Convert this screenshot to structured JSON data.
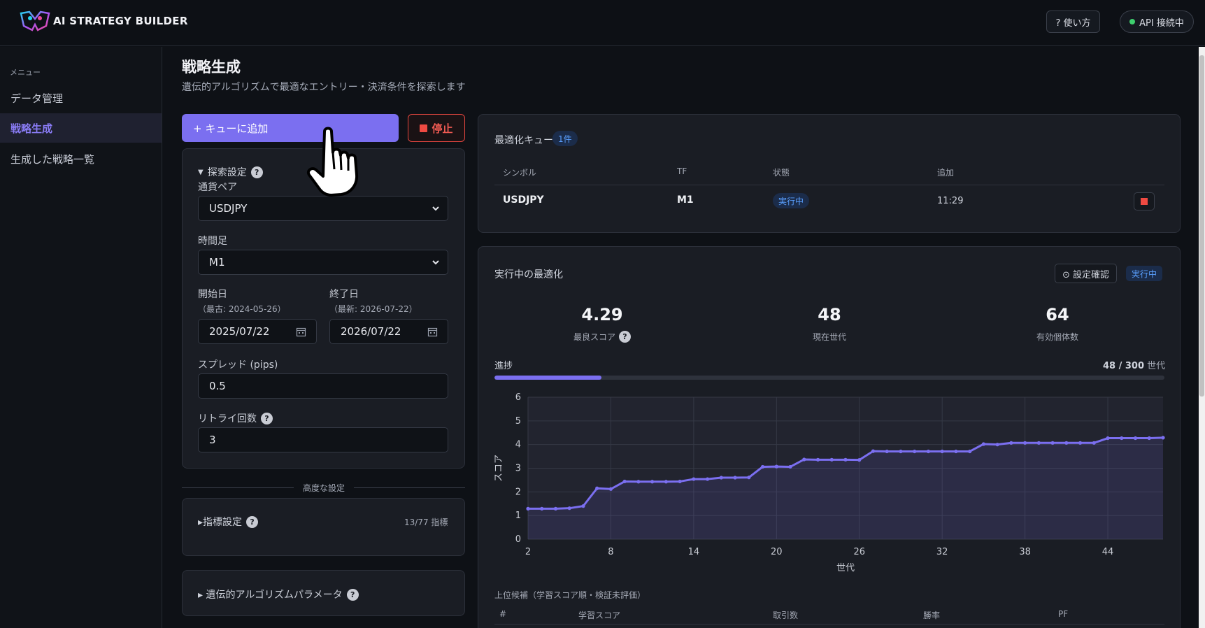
{
  "header": {
    "brand": "AI STRATEGY BUILDER",
    "help_label": "? 使い方",
    "api_status": "API 接続中",
    "api_color": "#3ecf6e"
  },
  "sidebar": {
    "caption": "メニュー",
    "items": [
      {
        "label": "データ管理",
        "active": false
      },
      {
        "label": "戦略生成",
        "active": true
      },
      {
        "label": "生成した戦略一覧",
        "active": false
      }
    ]
  },
  "page": {
    "title": "戦略生成",
    "subtitle": "遺伝的アルゴリズムで最適なエントリー・決済条件を探索します"
  },
  "actions": {
    "add_queue": "+ キューに追加",
    "stop": "停止"
  },
  "search": {
    "heading": "探索設定",
    "pair_label": "通貨ペア",
    "pair_value": "USDJPY",
    "tf_label": "時間足",
    "tf_value": "M1",
    "start_label": "開始日",
    "start_hint": "（最古: 2024-05-26）",
    "start_value": "2025/07/22",
    "end_label": "終了日",
    "end_hint": "（最新: 2026-07-22）",
    "end_value": "2026/07/22",
    "spread_label": "スプレッド (pips)",
    "spread_value": "0.5",
    "retry_label": "リトライ回数",
    "retry_value": "3"
  },
  "advanced": {
    "divider": "高度な設定",
    "indicators_label": "▸指標設定",
    "indicators_count": "13/77 指標",
    "ga_label": "▸ 遺伝的アルゴリズムパラメータ"
  },
  "queue": {
    "title": "最適化キュー",
    "count_badge": "1件",
    "columns": [
      "シンボル",
      "TF",
      "状態",
      "追加"
    ],
    "rows": [
      {
        "symbol": "USDJPY",
        "tf": "M1",
        "status": "実行中",
        "added": "11:29"
      }
    ]
  },
  "run": {
    "title": "実行中の最適化",
    "config_label": "⊙ 設定確認",
    "status_badge": "実行中",
    "stats": [
      {
        "value": "4.29",
        "label": "最良スコア"
      },
      {
        "value": "48",
        "label": "現在世代"
      },
      {
        "value": "64",
        "label": "有効個体数"
      }
    ],
    "progress_label": "進捗",
    "progress_current": "48 / 300",
    "progress_unit": " 世代",
    "progress_fraction": 0.16
  },
  "candidates": {
    "title": "上位候補（学習スコア順・検証未評価）",
    "columns": [
      "#",
      "学習スコア",
      "取引数",
      "勝率",
      "PF"
    ]
  },
  "chart_data": {
    "type": "area",
    "xlabel": "世代",
    "ylabel": "スコア",
    "xlim": [
      2,
      48
    ],
    "ylim": [
      0,
      6
    ],
    "xticks": [
      2,
      8,
      14,
      20,
      26,
      32,
      38,
      44
    ],
    "yticks": [
      0,
      1,
      2,
      3,
      4,
      5,
      6
    ],
    "line_color": "#7b6ff0",
    "x": [
      2,
      3,
      4,
      5,
      6,
      7,
      8,
      9,
      10,
      11,
      12,
      13,
      14,
      15,
      16,
      17,
      18,
      19,
      20,
      21,
      22,
      23,
      24,
      25,
      26,
      27,
      28,
      29,
      30,
      31,
      32,
      33,
      34,
      35,
      36,
      37,
      38,
      39,
      40,
      41,
      42,
      43,
      44,
      45,
      46,
      47,
      48
    ],
    "values": [
      1.29,
      1.29,
      1.29,
      1.31,
      1.4,
      2.15,
      2.12,
      2.44,
      2.43,
      2.43,
      2.43,
      2.44,
      2.54,
      2.54,
      2.6,
      2.6,
      2.61,
      3.06,
      3.07,
      3.06,
      3.37,
      3.36,
      3.36,
      3.36,
      3.35,
      3.72,
      3.71,
      3.71,
      3.71,
      3.71,
      3.71,
      3.71,
      3.71,
      4.02,
      4.0,
      4.07,
      4.07,
      4.07,
      4.07,
      4.07,
      4.07,
      4.07,
      4.27,
      4.27,
      4.27,
      4.27,
      4.29
    ]
  }
}
